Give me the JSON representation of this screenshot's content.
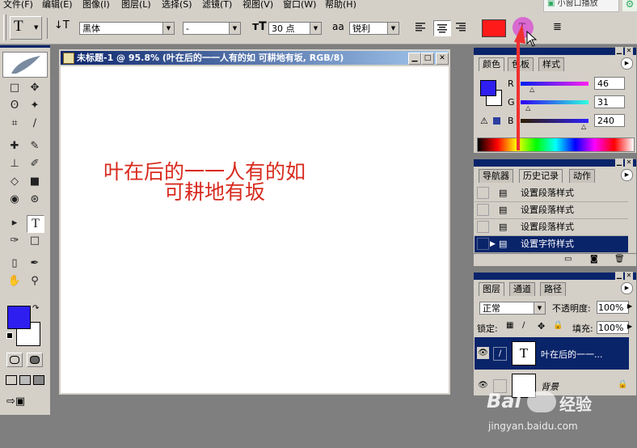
{
  "menubar": {
    "items": [
      "文件(F)",
      "编辑(E)",
      "图像(I)",
      "图层(L)",
      "选择(S)",
      "滤镜(T)",
      "视图(V)",
      "窗口(W)",
      "帮助(H)"
    ],
    "mini_window": "小窗口播放"
  },
  "options": {
    "tool_label": "T",
    "font_family": "黑体",
    "font_style": "-",
    "font_size": "30 点",
    "antialias_icon": "aa",
    "antialias": "锐利",
    "text_color": "#ff1a1a",
    "warp_icon": "T",
    "palette_icon": "≣"
  },
  "document": {
    "title": "未标题-1 @ 95.8% (叶在后的一一人有的如 可耕地有坂, RGB/8)",
    "text_line1": "叶在后的一一人有的如",
    "text_line2": "可耕地有坂",
    "text_color": "#d82a1e"
  },
  "toolbox": {
    "foreground_color": "#2e1ff0",
    "background_color": "#ffffff",
    "tools": [
      "□",
      "✥",
      "ʘ",
      "✦",
      "⌗",
      "∕",
      "✚",
      "✎",
      "⊥",
      "✐",
      "◇",
      "■",
      "◉",
      "⊛",
      "▸",
      "T",
      "✑",
      "□",
      "▯",
      "✒",
      "✋",
      "⚲"
    ]
  },
  "color_panel": {
    "tabs": [
      "颜色",
      "色板",
      "样式"
    ],
    "r_label": "R",
    "g_label": "G",
    "b_label": "B",
    "r": "46",
    "g": "31",
    "b": "240",
    "r_level": 0.18,
    "g_level": 0.12,
    "b_level": 0.94,
    "warning_icon": "⚠",
    "current_color": "#2e1ff0"
  },
  "history_panel": {
    "tabs": [
      "导航器",
      "历史记录",
      "动作"
    ],
    "rows": [
      "设置段落样式",
      "设置段落样式",
      "设置段落样式",
      "设置字符样式"
    ]
  },
  "layers_panel": {
    "tabs": [
      "图层",
      "通道",
      "路径"
    ],
    "blend_mode": "正常",
    "opacity_label": "不透明度:",
    "opacity": "100%",
    "lock_label": "锁定:",
    "fill_label": "填充:",
    "fill": "100%",
    "layers": [
      {
        "name": "叶在后的一一...",
        "thumb": "T"
      },
      {
        "name": "背景",
        "thumb": ""
      }
    ]
  },
  "watermark": {
    "brand": "Bai",
    "brand2": "经验",
    "url": "jingyan.baidu.com"
  }
}
